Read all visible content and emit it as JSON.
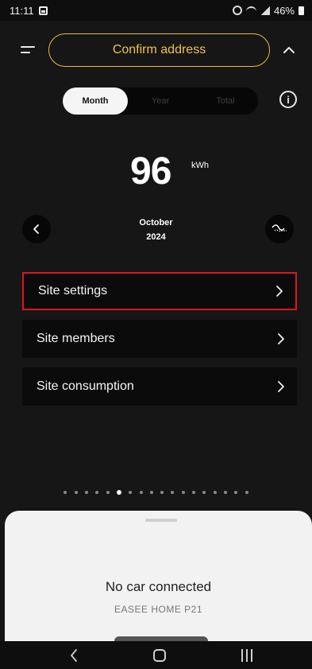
{
  "status_bar": {
    "time": "11:11",
    "battery": "46%"
  },
  "header": {
    "confirm_label": "Confirm address"
  },
  "period_tabs": [
    {
      "label": "Month",
      "active": true
    },
    {
      "label": "Year",
      "active": false
    },
    {
      "label": "Total",
      "active": false
    }
  ],
  "energy": {
    "value": "96",
    "unit": "kWh",
    "period_month": "October",
    "period_year": "2024"
  },
  "site_menu": [
    {
      "label": "Site settings",
      "highlighted": true
    },
    {
      "label": "Site members",
      "highlighted": false
    },
    {
      "label": "Site consumption",
      "highlighted": false
    }
  ],
  "pager": {
    "count": 18,
    "active_index": 5
  },
  "charger_sheet": {
    "car_status": "No car connected",
    "charger_name": "EASEE HOME P21"
  },
  "colors": {
    "accent": "#f0c24a",
    "highlight": "#e0141c",
    "background": "#161616"
  }
}
